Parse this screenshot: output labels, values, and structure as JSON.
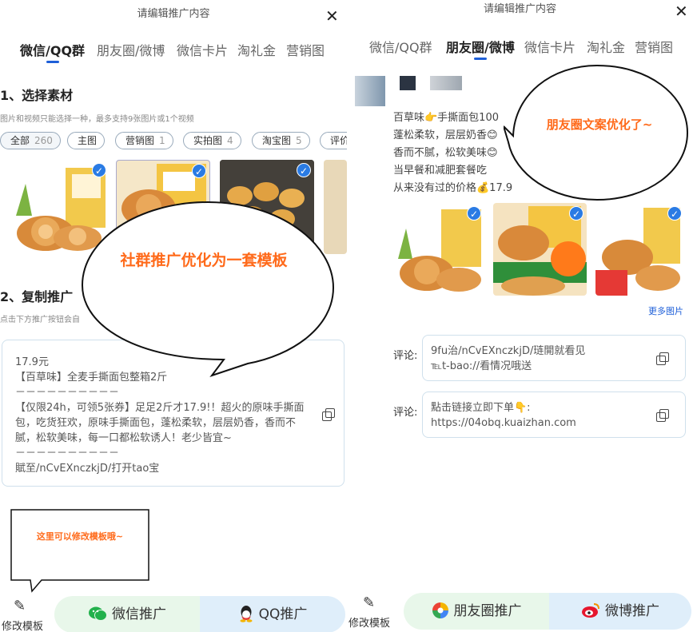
{
  "left": {
    "header_title": "请编辑推广内容",
    "close_glyph": "✕",
    "tabs": [
      "微信/QQ群",
      "朋友圈/微博",
      "微信卡片",
      "淘礼金",
      "营销图"
    ],
    "section1_title": "1、选择素材",
    "section1_hint": "图片和视频只能选择一种，最多支持9张图片或1个视频",
    "chips": [
      {
        "label": "全部",
        "count": "260"
      },
      {
        "label": "主图",
        "count": ""
      },
      {
        "label": "营销图",
        "count": "1"
      },
      {
        "label": "实拍图",
        "count": "4"
      },
      {
        "label": "淘宝图",
        "count": "5"
      },
      {
        "label": "评价",
        "count": ""
      }
    ],
    "section2_title": "2、复制推广",
    "section2_hint": "点击下方推广按钮会自",
    "template": {
      "price": "17.9元",
      "name": "【百草味】全麦手撕面包整箱2斤",
      "dash1": "－－－－－－－－－－",
      "desc": "【仅限24h，可领5张券】足足2斤才17.9!！超火的原味手撕面包，吃货狂欢，原味手撕面包，蓬松柔软，层层奶香，香而不腻，松软美味，每一口都松软诱人！老少皆宜~",
      "dash2": "－－－－－－－－－－",
      "link": "賦至/nCvEXnczkjD/打开tao宝"
    },
    "bubble_text": "社群推广优化为一套模板",
    "note_text": "这里可以修改模板哦~",
    "edit_label": "修改模板",
    "btn_wechat": "微信推广",
    "btn_qq": "QQ推广"
  },
  "right": {
    "header_title": "请编辑推广内容",
    "close_glyph": "✕",
    "tabs": [
      "微信/QQ群",
      "朋友圈/微博",
      "微信卡片",
      "淘礼金",
      "营销图"
    ],
    "moment_lines": [
      "百草味👉手撕面包100",
      "蓬松柔软，层层奶香😊",
      "香而不腻，松软美味😊",
      "当早餐和减肥套餐吃",
      "从来没有过的价格💰17.9"
    ],
    "bubble_text": "朋友圈文案优化了~",
    "more_images": "更多图片",
    "comment_label": "评论:",
    "comment1_line1": "9fu治/nCvEXnczkjD/琏開就看见",
    "comment1_line2": "℡t-bao://看情况哦送",
    "comment2_line1": "點击链接立即下单👇:",
    "comment2_line2": "https://04obq.kuaizhan.com",
    "edit_label": "修改模板",
    "btn_moments": "朋友圈推广",
    "btn_weibo": "微博推广"
  },
  "colors": {
    "accent_blue": "#1e5fd8",
    "bubble_orange": "#ff6a1a",
    "wechat_btn_bg": "#e8f7ea",
    "qq_btn_bg": "#dfeefa",
    "wechat_green": "#22b14c"
  },
  "icons": [
    "close-icon",
    "check-icon",
    "copy-icon",
    "edit-pencil-icon",
    "wechat-icon",
    "qq-icon",
    "moments-icon",
    "weibo-icon"
  ]
}
